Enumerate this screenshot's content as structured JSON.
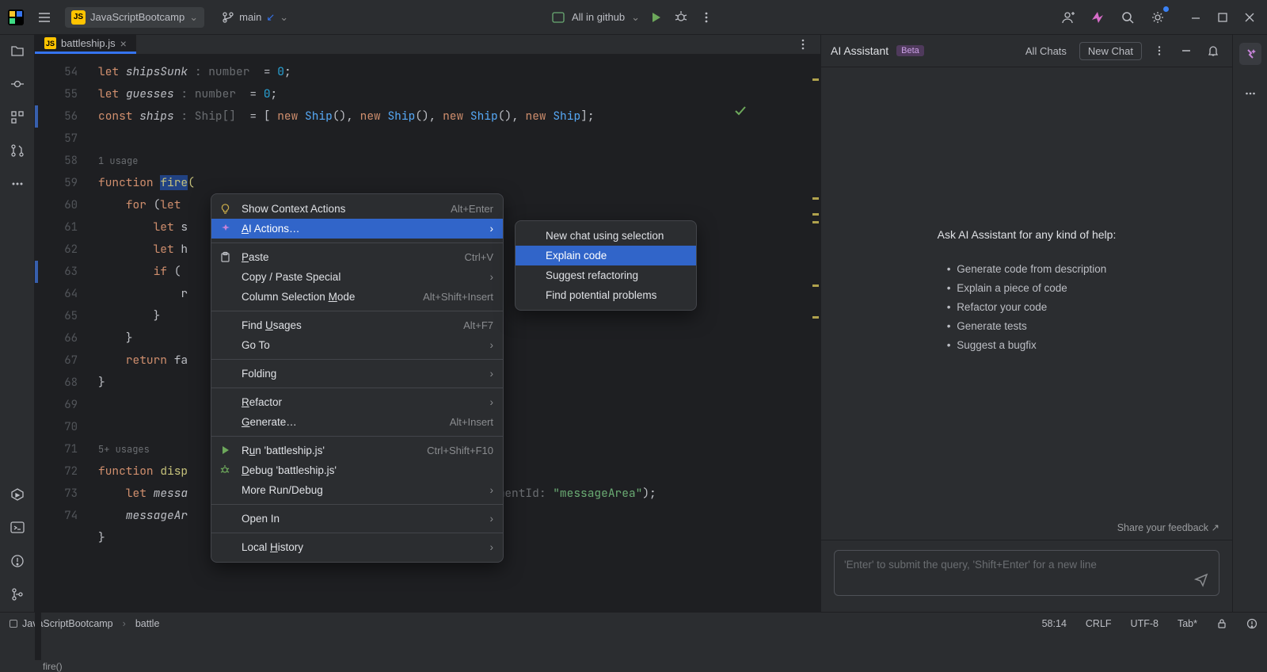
{
  "titlebar": {
    "project_name": "JavaScriptBootcamp",
    "branch": "main",
    "center_label": "All in github"
  },
  "tab": {
    "filename": "battleship.js"
  },
  "code": {
    "lines": [
      {
        "n": 54,
        "html": "<span class='kw'>let</span> <span class='ident'>shipsSunk</span> <span class='type'>: number</span> &nbsp;= <span class='num'>0</span>;"
      },
      {
        "n": 55,
        "html": "<span class='kw'>let</span> <span class='ident'>guesses</span> <span class='type'>: number</span> &nbsp;= <span class='num'>0</span>;"
      },
      {
        "n": 56,
        "html": "<span class='kw'>const</span> <span class='ident'>ships</span> <span class='type'>: Ship[]</span> &nbsp;= [ <span class='new-kw'>new</span> <span class='fn'>Ship</span>(), <span class='new-kw'>new</span> <span class='fn'>Ship</span>(), <span class='new-kw'>new</span> <span class='fn'>Ship</span>(), <span class='new-kw'>new</span> <span class='fn'>Ship</span>];"
      },
      {
        "n": 57,
        "html": ""
      },
      {
        "n": "",
        "html": "<span class='usg'>1 usage</span>"
      },
      {
        "n": 58,
        "html": "<span class='kw'>function</span> <span class='hl'><span class='sel'>fire</span>(</span>"
      },
      {
        "n": 59,
        "html": "    <span class='kw'>for</span> (<span class='kw'>let</span>"
      },
      {
        "n": 60,
        "html": "        <span class='kw'>let</span> s"
      },
      {
        "n": 61,
        "html": "        <span class='kw'>let</span> h"
      },
      {
        "n": 62,
        "html": "        <span class='kw'>if</span> ("
      },
      {
        "n": 63,
        "html": "            r"
      },
      {
        "n": 64,
        "html": "        }"
      },
      {
        "n": 65,
        "html": "    }"
      },
      {
        "n": 66,
        "html": "    <span class='kw'>return</span> fa"
      },
      {
        "n": 67,
        "html": "}"
      },
      {
        "n": 68,
        "html": ""
      },
      {
        "n": 69,
        "html": ""
      },
      {
        "n": "",
        "html": "<span class='usg'>5+ usages</span>"
      },
      {
        "n": 70,
        "html": "<span class='kw'>function</span> <span class='hl'>disp</span>"
      },
      {
        "n": 71,
        "html": "    <span class='kw'>let</span> <span class='ident'>messa</span>                                   tById( <span class='param'>elementId:</span> <span class='str'>\"messageArea\"</span>);"
      },
      {
        "n": 72,
        "html": "    <span class='ident'>messageAr</span>"
      },
      {
        "n": 73,
        "html": "}"
      },
      {
        "n": 74,
        "html": ""
      }
    ]
  },
  "breadcrumb": "fire()",
  "context_menu": {
    "items": [
      {
        "label_html": "Show Context Actions",
        "shortcut": "Alt+Enter",
        "icon": "bulb"
      },
      {
        "label_html": "<span class='u'>A</span>I Actions…",
        "submenu": true,
        "selected": true,
        "icon": "ai"
      },
      {
        "separator": true
      },
      {
        "label_html": "<span class='u'>P</span>aste",
        "shortcut": "Ctrl+V",
        "icon": "paste"
      },
      {
        "label_html": "Copy / Paste Special",
        "submenu": true
      },
      {
        "label_html": "Column Selection <span class='u'>M</span>ode",
        "shortcut": "Alt+Shift+Insert"
      },
      {
        "separator": true
      },
      {
        "label_html": "Find <span class='u'>U</span>sages",
        "shortcut": "Alt+F7"
      },
      {
        "label_html": "Go To",
        "submenu": true
      },
      {
        "separator": true
      },
      {
        "label_html": "Folding",
        "submenu": true
      },
      {
        "separator": true
      },
      {
        "label_html": "<span class='u'>R</span>efactor",
        "submenu": true
      },
      {
        "label_html": "<span class='u'>G</span>enerate…",
        "shortcut": "Alt+Insert"
      },
      {
        "separator": true
      },
      {
        "label_html": "R<span class='u'>u</span>n 'battleship.js'",
        "shortcut": "Ctrl+Shift+F10",
        "icon": "run"
      },
      {
        "label_html": "<span class='u'>D</span>ebug 'battleship.js'",
        "icon": "debug"
      },
      {
        "label_html": "More Run/Debug",
        "submenu": true
      },
      {
        "separator": true
      },
      {
        "label_html": "Open In",
        "submenu": true
      },
      {
        "separator": true
      },
      {
        "label_html": "Local <span class='u'>H</span>istory",
        "submenu": true
      }
    ],
    "submenu": [
      {
        "label": "New chat using selection"
      },
      {
        "label": "Explain code",
        "selected": true
      },
      {
        "label": "Suggest refactoring"
      },
      {
        "label": "Find potential problems"
      }
    ]
  },
  "ai": {
    "title": "AI Assistant",
    "badge": "Beta",
    "tab_all": "All Chats",
    "tab_new": "New Chat",
    "heading": "Ask AI Assistant for any kind of help:",
    "bullets": [
      "Generate code from description",
      "Explain a piece of code",
      "Refactor your code",
      "Generate tests",
      "Suggest a bugfix"
    ],
    "feedback": "Share your feedback ↗",
    "placeholder": "'Enter' to submit the query, 'Shift+Enter' for a new line"
  },
  "statusbar": {
    "project": "JavaScriptBootcamp",
    "file": "battle",
    "pos": "58:14",
    "eol": "CRLF",
    "enc": "UTF-8",
    "indent": "Tab*"
  }
}
